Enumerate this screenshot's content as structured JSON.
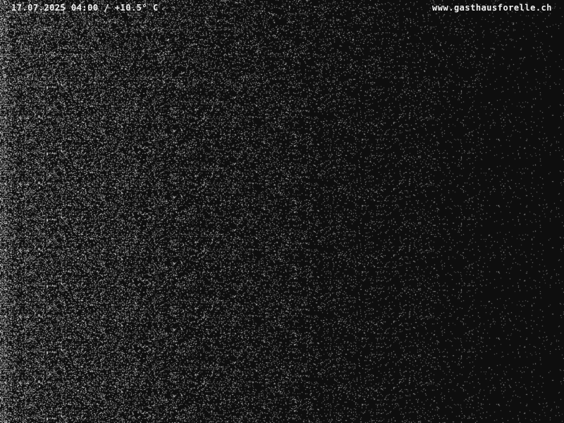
{
  "overlay": {
    "timestamp": "17.07.2025 04:00 / +10.5° C",
    "website": "www.gasthausforelle.ch"
  },
  "image": {
    "scene": "night-webcam-noise",
    "background_color": "#0e0e0e",
    "noise_color": "#bfbfbf",
    "text_color": "#f2f2f2"
  }
}
